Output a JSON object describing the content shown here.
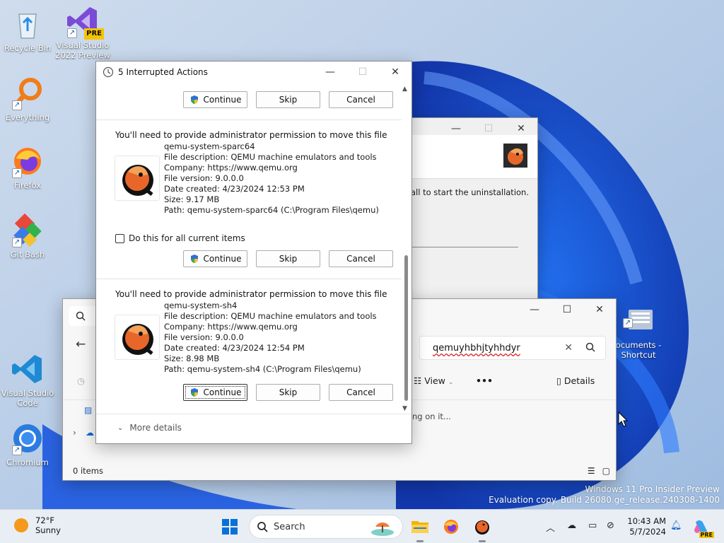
{
  "desktop": {
    "icons": [
      {
        "label": "Recycle Bin"
      },
      {
        "label": "Visual Studio 2022 Preview",
        "badge": "PRE"
      },
      {
        "label": "Everything"
      },
      {
        "label": "Firefox"
      },
      {
        "label": "Git Bash"
      },
      {
        "label": "Visual Studio Code"
      },
      {
        "label": "Chromium"
      },
      {
        "label": "Documents - Shortcut",
        "visible_text": "ocuments -\nShortcut"
      }
    ],
    "watermark": {
      "line1": "Windows 11 Pro Insider Preview",
      "line2": "Evaluation copy. Build 26080.ge_release.240308-1400"
    }
  },
  "uninstall_window": {
    "message": "all to start the uninstallation."
  },
  "explorer": {
    "search_value": "qemuyhbhjtyhhdyr",
    "toolbar": {
      "view_label": "View",
      "more_label": "•••",
      "details_label": "Details"
    },
    "empty_message": "ng on it...",
    "status": "0 items"
  },
  "dialog": {
    "title": "5 Interrupted Actions",
    "buttons": {
      "continue": "Continue",
      "skip": "Skip",
      "cancel": "Cancel"
    },
    "checkbox_label": "Do this for all current items",
    "more_details": "More details",
    "items": [
      {
        "heading": "You'll need to provide administrator permission to move this file",
        "name": "qemu-system-sparc64",
        "description": "File description: QEMU machine emulators and tools",
        "company": "Company: https://www.qemu.org",
        "version": "File version: 9.0.0.0",
        "created": "Date created: 4/23/2024 12:53 PM",
        "size": "Size: 9.17 MB",
        "path": "Path: qemu-system-sparc64 (C:\\Program Files\\qemu)"
      },
      {
        "heading": "You'll need to provide administrator permission to move this file",
        "name": "qemu-system-sh4",
        "description": "File description: QEMU machine emulators and tools",
        "company": "Company: https://www.qemu.org",
        "version": "File version: 9.0.0.0",
        "created": "Date created: 4/23/2024 12:54 PM",
        "size": "Size: 8.98 MB",
        "path": "Path: qemu-system-sh4 (C:\\Program Files\\qemu)"
      }
    ]
  },
  "taskbar": {
    "weather": {
      "temp": "72°F",
      "condition": "Sunny"
    },
    "search_placeholder": "Search",
    "clock": {
      "time": "10:43 AM",
      "date": "5/7/2024"
    },
    "copilot_badge": "PRE"
  },
  "colors": {
    "accent": "#0067c0",
    "qemu_orange": "#e8662a"
  }
}
